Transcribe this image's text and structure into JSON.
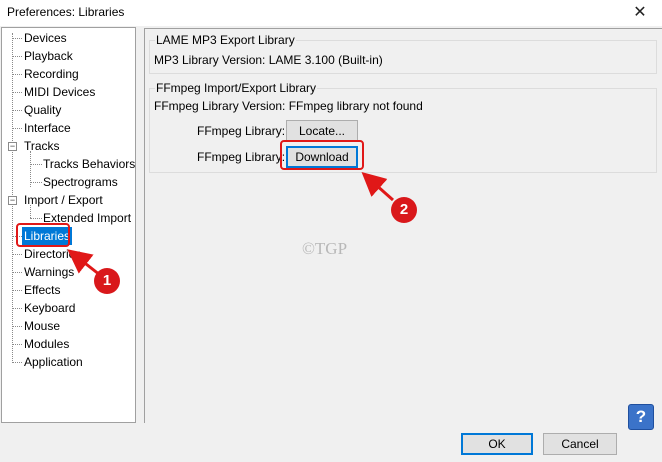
{
  "window": {
    "title": "Preferences: Libraries",
    "close_glyph": "✕"
  },
  "tree": {
    "items": [
      {
        "label": "Devices"
      },
      {
        "label": "Playback"
      },
      {
        "label": "Recording"
      },
      {
        "label": "MIDI Devices"
      },
      {
        "label": "Quality"
      },
      {
        "label": "Interface"
      },
      {
        "label": "Tracks"
      },
      {
        "label": "Tracks Behaviors"
      },
      {
        "label": "Spectrograms"
      },
      {
        "label": "Import / Export"
      },
      {
        "label": "Extended Import"
      },
      {
        "label": "Libraries"
      },
      {
        "label": "Directories"
      },
      {
        "label": "Warnings"
      },
      {
        "label": "Effects"
      },
      {
        "label": "Keyboard"
      },
      {
        "label": "Mouse"
      },
      {
        "label": "Modules"
      },
      {
        "label": "Application"
      }
    ],
    "expander_glyph": "−"
  },
  "lame": {
    "group_title": "LAME MP3 Export Library",
    "version_text": "MP3 Library Version: LAME 3.100 (Built-in)"
  },
  "ffmpeg": {
    "group_title": "FFmpeg Import/Export Library",
    "version_text": "FFmpeg Library Version: FFmpeg library not found",
    "locate_label": "FFmpeg Library:",
    "locate_button": "Locate...",
    "download_label": "FFmpeg Library:",
    "download_button": "Download"
  },
  "footer": {
    "ok_button": "OK",
    "cancel_button": "Cancel",
    "help_glyph": "?"
  },
  "annotations": {
    "callout_1": "1",
    "callout_2": "2",
    "watermark": "©TGP",
    "highlight_color": "#e01818"
  }
}
